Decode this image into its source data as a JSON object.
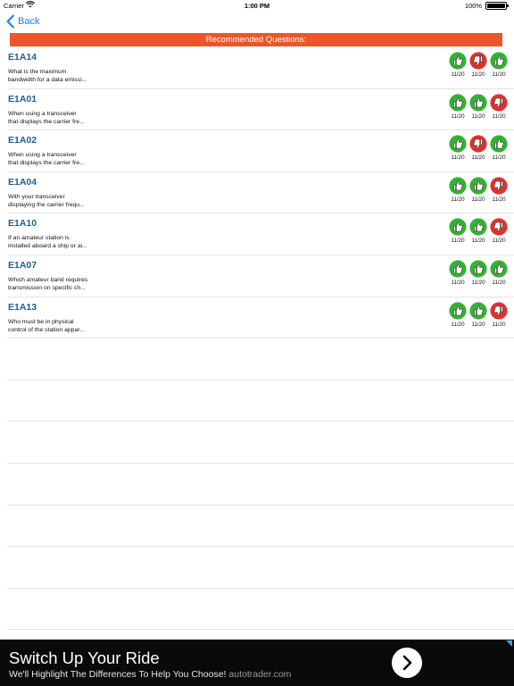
{
  "status_bar": {
    "carrier": "Carrier",
    "time": "1:00 PM",
    "battery": "100%"
  },
  "nav": {
    "back_label": "Back"
  },
  "section_header": "Recommended Questions:",
  "questions": [
    {
      "code": "E1A14",
      "line1": "What is the maximum",
      "line2": "bandwidth for a data emissi...",
      "thumbs": [
        "up",
        "down",
        "up"
      ],
      "counts": [
        "11/20",
        "11/20",
        "11/20"
      ]
    },
    {
      "code": "E1A01",
      "line1": "When using a transceiver",
      "line2": "that displays the carrier fre...",
      "thumbs": [
        "up",
        "up",
        "down"
      ],
      "counts": [
        "11/20",
        "11/20",
        "11/20"
      ]
    },
    {
      "code": "E1A02",
      "line1": "When using a transceiver",
      "line2": "that displays the carrier fre...",
      "thumbs": [
        "up",
        "down",
        "up"
      ],
      "counts": [
        "11/20",
        "11/20",
        "11/20"
      ]
    },
    {
      "code": "E1A04",
      "line1": "With your transceiver",
      "line2": "displaying the carrier frequ...",
      "thumbs": [
        "up",
        "up",
        "down"
      ],
      "counts": [
        "11/20",
        "11/20",
        "11/20"
      ]
    },
    {
      "code": "E1A10",
      "line1": "If an amateur station is",
      "line2": "installed aboard a ship or ai...",
      "thumbs": [
        "up",
        "up",
        "down"
      ],
      "counts": [
        "11/20",
        "11/20",
        "11/20"
      ]
    },
    {
      "code": "E1A07",
      "line1": "Which amateur band requires",
      "line2": "transmission on specific ch...",
      "thumbs": [
        "up",
        "up",
        "up"
      ],
      "counts": [
        "11/20",
        "11/20",
        "11/20"
      ]
    },
    {
      "code": "E1A13",
      "line1": "Who must be in physical",
      "line2": "control of the station appar...",
      "thumbs": [
        "up",
        "up",
        "down"
      ],
      "counts": [
        "11/20",
        "11/20",
        "11/20"
      ]
    }
  ],
  "colors": {
    "up": "#34b233",
    "down": "#e0312f",
    "header": "#e8572a",
    "code": "#1f5e8e",
    "link": "#1a7ef4"
  },
  "ad": {
    "headline": "Switch Up Your Ride",
    "subtext": "We'll Highlight The Differences To Help You Choose!",
    "domain": "autotrader.com",
    "arrow_icon": "chevron-right-icon"
  }
}
